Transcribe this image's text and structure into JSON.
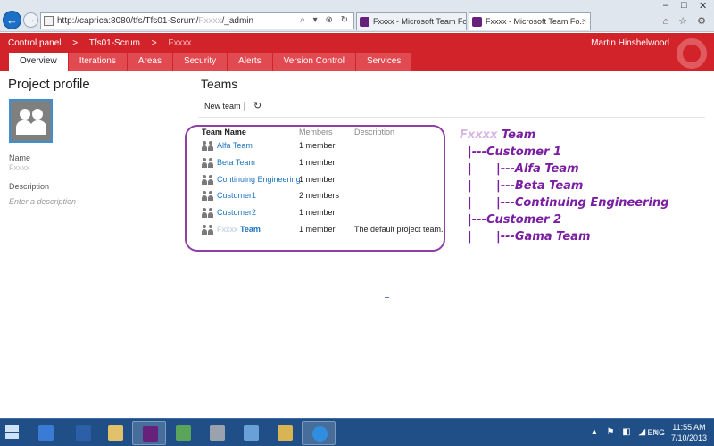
{
  "browser": {
    "back_glyph": "←",
    "forward_glyph": "→",
    "url_prefix": "http://caprica:8080/tfs/Tfs01-Scrum/",
    "url_blurred": "Fxxxx",
    "url_suffix": "/_admin",
    "address_controls": "⌕ ▾ ⊗ ↻",
    "tabs": [
      {
        "label": "Fxxxx - Microsoft Team Fou...",
        "active": false
      },
      {
        "label": "Fxxxx - Microsoft Team Fo...",
        "active": true
      }
    ],
    "tab_close": "×",
    "window_controls": [
      "–",
      "□",
      "✕"
    ],
    "toolbar_icons": "⌂ ☆ ⚙"
  },
  "header": {
    "breadcrumb": [
      "Control panel",
      ">",
      "Tfs01-Scrum",
      ">"
    ],
    "breadcrumb_blurred": "Fxxxx",
    "user": "Martin Hinshelwood",
    "tabs": [
      {
        "label": "Overview",
        "active": true
      },
      {
        "label": "Iterations",
        "active": false
      },
      {
        "label": "Areas",
        "active": false
      },
      {
        "label": "Security",
        "active": false
      },
      {
        "label": "Alerts",
        "active": false
      },
      {
        "label": "Version Control",
        "active": false
      },
      {
        "label": "Services",
        "active": false
      }
    ]
  },
  "profile": {
    "title": "Project profile",
    "name_label": "Name",
    "name_value": "Fxxxx",
    "description_label": "Description",
    "description_placeholder": "Enter a description"
  },
  "teams": {
    "title": "Teams",
    "new_team_label": "New team",
    "refresh_glyph": "↻",
    "columns": {
      "name": "Team Name",
      "members": "Members",
      "description": "Description"
    },
    "rows": [
      {
        "name": "Alfa Team",
        "members": "1 member",
        "description": ""
      },
      {
        "name": "Beta Team",
        "members": "1 member",
        "description": ""
      },
      {
        "name": "Continuing Engineering",
        "members": "1 member",
        "description": ""
      },
      {
        "name": "Customer1",
        "members": "2 members",
        "description": ""
      },
      {
        "name": "Customer2",
        "members": "1 member",
        "description": ""
      },
      {
        "name_blurred": "Fxxxx",
        "name": "Team",
        "members": "1 member",
        "description": "The default project team."
      }
    ]
  },
  "annotation": {
    "color": "#7b1fa2",
    "lines": [
      {
        "blurred": "Fxxxx",
        "text": " Team"
      },
      {
        "text": "  |---Customer 1"
      },
      {
        "text": "  |      |---Alfa Team"
      },
      {
        "text": "  |      |---Beta Team"
      },
      {
        "text": "  |      |---Continuing Engineering"
      },
      {
        "text": "  |---Customer 2"
      },
      {
        "text": "  |      |---Gama Team"
      }
    ]
  },
  "taskbar": {
    "tray_icons": "▲ ⚑ ◧ ◢ ♪",
    "language": "ENG",
    "time": "11:55 AM",
    "date": "7/10/2013"
  },
  "colors": {
    "accent_red": "#d2232a",
    "link_blue": "#1e73be",
    "highlight_purple": "#8e3fa8"
  }
}
